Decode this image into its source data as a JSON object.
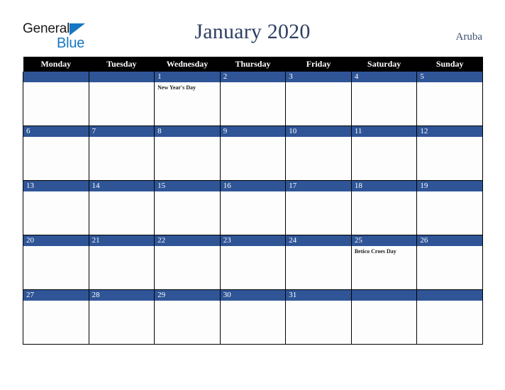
{
  "brand": {
    "name_part1": "General",
    "name_part2": "Blue",
    "triangle_color": "#1577c4",
    "text_color": "#1a1a1a"
  },
  "header": {
    "title": "January 2020",
    "country": "Aruba",
    "title_color": "#2d3f62"
  },
  "calendar": {
    "accent_color": "#2f5597",
    "header_bg": "#000000",
    "header_text_color": "#ffffff",
    "weekdays": [
      "Monday",
      "Tuesday",
      "Wednesday",
      "Thursday",
      "Friday",
      "Saturday",
      "Sunday"
    ],
    "weeks": [
      [
        {
          "day": "",
          "event": ""
        },
        {
          "day": "",
          "event": ""
        },
        {
          "day": "1",
          "event": "New Year's Day"
        },
        {
          "day": "2",
          "event": ""
        },
        {
          "day": "3",
          "event": ""
        },
        {
          "day": "4",
          "event": ""
        },
        {
          "day": "5",
          "event": ""
        }
      ],
      [
        {
          "day": "6",
          "event": ""
        },
        {
          "day": "7",
          "event": ""
        },
        {
          "day": "8",
          "event": ""
        },
        {
          "day": "9",
          "event": ""
        },
        {
          "day": "10",
          "event": ""
        },
        {
          "day": "11",
          "event": ""
        },
        {
          "day": "12",
          "event": ""
        }
      ],
      [
        {
          "day": "13",
          "event": ""
        },
        {
          "day": "14",
          "event": ""
        },
        {
          "day": "15",
          "event": ""
        },
        {
          "day": "16",
          "event": ""
        },
        {
          "day": "17",
          "event": ""
        },
        {
          "day": "18",
          "event": ""
        },
        {
          "day": "19",
          "event": ""
        }
      ],
      [
        {
          "day": "20",
          "event": ""
        },
        {
          "day": "21",
          "event": ""
        },
        {
          "day": "22",
          "event": ""
        },
        {
          "day": "23",
          "event": ""
        },
        {
          "day": "24",
          "event": ""
        },
        {
          "day": "25",
          "event": "Betico Croes Day"
        },
        {
          "day": "26",
          "event": ""
        }
      ],
      [
        {
          "day": "27",
          "event": ""
        },
        {
          "day": "28",
          "event": ""
        },
        {
          "day": "29",
          "event": ""
        },
        {
          "day": "30",
          "event": ""
        },
        {
          "day": "31",
          "event": ""
        },
        {
          "day": "",
          "event": ""
        },
        {
          "day": "",
          "event": ""
        }
      ]
    ]
  }
}
